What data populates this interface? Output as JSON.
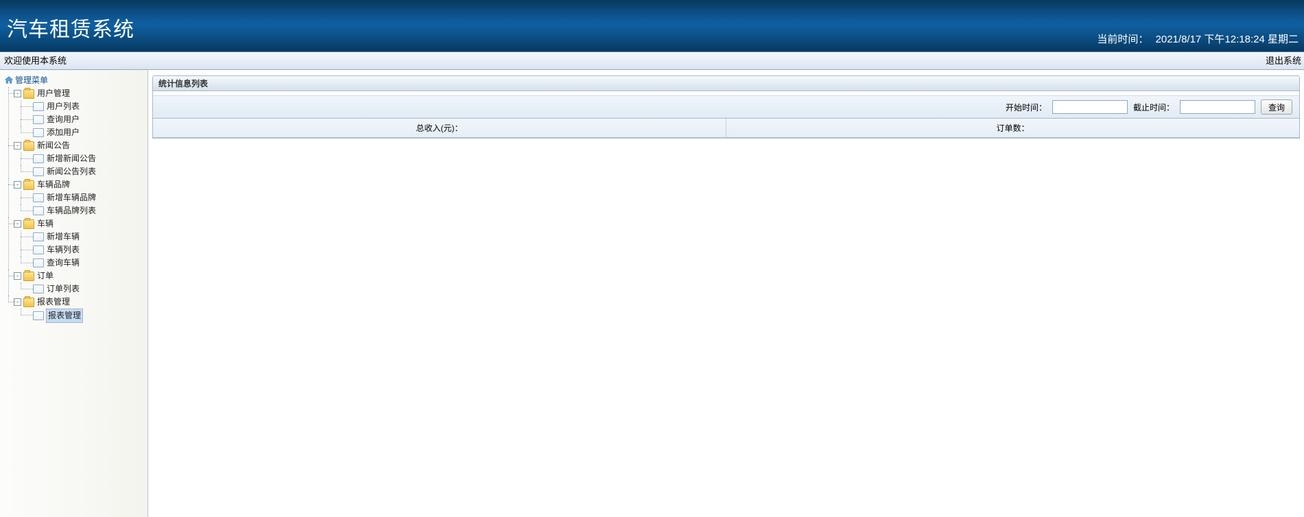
{
  "header": {
    "title": "汽车租赁系统",
    "clock_label": "当前时间：",
    "clock_value": "2021/8/17 下午12:18:24 星期二"
  },
  "subbar": {
    "welcome": "欢迎使用本系统",
    "logout": "退出系统"
  },
  "tree": {
    "root": "管理菜单",
    "nodes": [
      {
        "label": "用户管理",
        "children": [
          "用户列表",
          "查询用户",
          "添加用户"
        ]
      },
      {
        "label": "新闻公告",
        "children": [
          "新增新闻公告",
          "新闻公告列表"
        ]
      },
      {
        "label": "车辆品牌",
        "children": [
          "新增车辆品牌",
          "车辆品牌列表"
        ]
      },
      {
        "label": "车辆",
        "children": [
          "新增车辆",
          "车辆列表",
          "查询车辆"
        ]
      },
      {
        "label": "订单",
        "children": [
          "订单列表"
        ]
      },
      {
        "label": "报表管理",
        "children": [
          "报表管理"
        ],
        "selected_child": 0
      }
    ]
  },
  "panel": {
    "title": "统计信息列表",
    "start_label": "开始时间：",
    "end_label": "截止时间：",
    "query_btn": "查询",
    "col_income": "总收入(元)：",
    "col_orders": "订单数："
  }
}
